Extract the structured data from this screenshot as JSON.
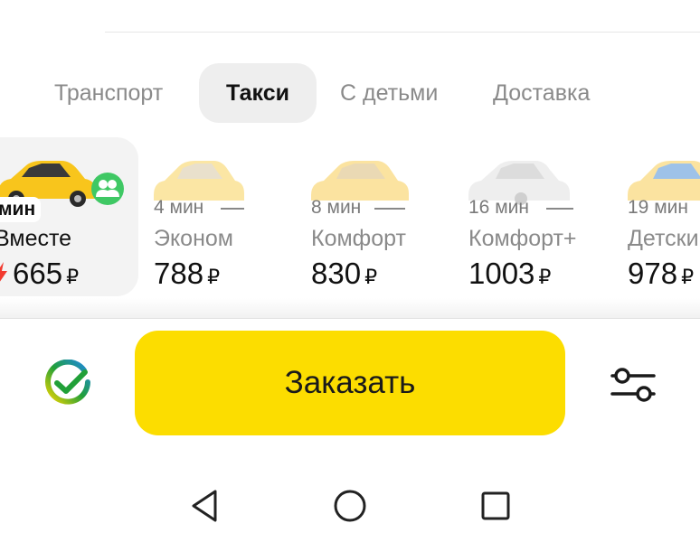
{
  "tabs": [
    {
      "label": "Транспорт",
      "active": false
    },
    {
      "label": "Такси",
      "active": true
    },
    {
      "label": "С детьми",
      "active": false
    },
    {
      "label": "Доставка",
      "active": false
    }
  ],
  "tariffs": [
    {
      "eta": "мин",
      "name": "Вместе",
      "price": "665",
      "currency": "₽",
      "selected": true,
      "surge": true,
      "icon": "group-icon"
    },
    {
      "eta": "4 мин",
      "name": "Эконом",
      "price": "788",
      "currency": "₽"
    },
    {
      "eta": "8 мин",
      "name": "Комфорт",
      "price": "830",
      "currency": "₽"
    },
    {
      "eta": "16 мин",
      "name": "Комфорт+",
      "price": "1003",
      "currency": "₽"
    },
    {
      "eta": "19 мин",
      "name": "Детски",
      "price": "978",
      "currency": "₽"
    }
  ],
  "order_button": {
    "label": "Заказать"
  },
  "icons": {
    "payment": "sberpay-check-icon",
    "settings": "sliders-settings-icon",
    "nav_back": "triangle-back-icon",
    "nav_home": "circle-home-icon",
    "nav_recents": "square-recents-icon"
  },
  "colors": {
    "accent": "#fcdd00",
    "car_yellow": "#f8c51c",
    "surge": "#f23a2f",
    "group_badge": "#3fc864"
  }
}
